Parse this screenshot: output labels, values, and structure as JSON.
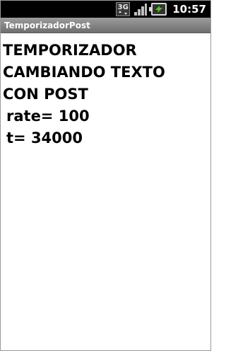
{
  "status_bar": {
    "network_label": "3G",
    "time": "10:57",
    "icons": [
      "3g-data-icon",
      "signal-strength-icon",
      "battery-charging-icon"
    ]
  },
  "app": {
    "title": "TemporizadorPost"
  },
  "content": {
    "heading_line_1": "TEMPORIZADOR",
    "heading_line_2": "CAMBIANDO TEXTO",
    "heading_line_3": "CON POST",
    "rate_text": "rate= 100",
    "t_text": "t= 34000"
  },
  "colors": {
    "status_bar_bg": "#000000",
    "title_bar_bg": "#7f7f7f",
    "content_bg": "#ffffff",
    "battery_accent": "#56c51e"
  }
}
